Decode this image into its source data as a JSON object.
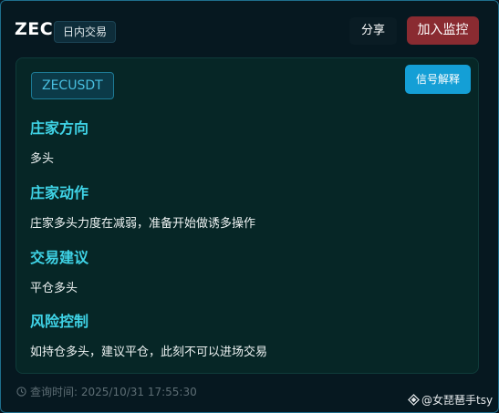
{
  "header": {
    "symbol": "ZEC",
    "type_badge": "日内交易",
    "share_label": "分享",
    "monitor_label": "加入监控"
  },
  "card": {
    "pair": "ZECUSDT",
    "explain_label": "信号解释",
    "sections": [
      {
        "title": "庄家方向",
        "text": "多头"
      },
      {
        "title": "庄家动作",
        "text": "庄家多头力度在减弱，准备开始做诱多操作"
      },
      {
        "title": "交易建议",
        "text": "平仓多头"
      },
      {
        "title": "风险控制",
        "text": "如持仓多头，建议平仓，此刻不可以进场交易"
      }
    ]
  },
  "footer": {
    "query_time": "查询时间: 2025/10/31 17:55:30",
    "watermark": "@女琵琶手tsy"
  },
  "colors": {
    "accent_title": "#3fd3e6",
    "monitor_button": "#8a2b31",
    "explain_button": "#149fd6"
  },
  "icons": [
    "clock-icon",
    "diamond-logo-icon"
  ]
}
